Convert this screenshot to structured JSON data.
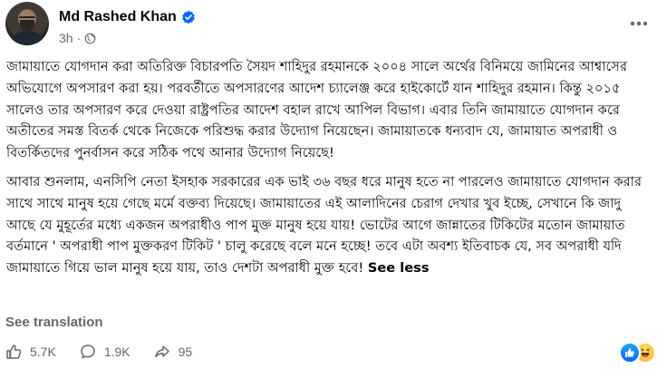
{
  "post": {
    "author": "Md Rashed Khan",
    "time": "3h",
    "separator": "·",
    "paragraph_1": "জামায়াতে যোগদান করা অতিরিক্ত বিচারপতি সৈয়দ শাহিদুর রহমানকে ২০০৪ সালে অর্থের বিনিময়ে জামিনের আশ্বাসের অভিযোগে অপসারণ করা হয়। পরবর্তীতে অপসারণের আদেশ চ্যালেঞ্জ করে হাইকোর্টে যান শাহিদুর রহমান। কিন্তু ২০১৫ সালেও তার অপসারণ করে দেওয়া রাষ্ট্রপতির আদেশ বহাল রাখে আপিল বিভাগ। এবার তিনি জামায়াতে যোগদান করে অতীতের সমস্ত বিতর্ক থেকে নিজেকে পরিশুদ্ধ করার উদ্যোগ নিয়েছেন। জামায়াতকে ধন্যবাদ যে, জামায়াত অপরাধী ও বিতর্কিতদের পুনর্বাসন করে সঠিক পথে আনার উদ্যোগ নিয়েছে!",
    "paragraph_2": "আবার শুনলাম, এনসিপি নেতা ইসহাক সরকারের এক ভাই ৩৬ বছর ধরে মানুষ হতে না পারলেও জামায়াতে যোগদান করার সাথে সাথে মানুষ হয়ে গেছে মর্মে বক্তব্য দিয়েছে। জামায়াতের এই আলাদিনের চেরাগ দেখার খুব ইচ্ছে, সেখানে কি জাদু আছে যে মুহূর্তের মধ্যে একজন অপরাধীও পাপ মুক্ত মানুষ হয়ে যায়! ভোটের আগে জান্নাতের টিকিটের মতোন জামায়াত বর্তমানে ' অপরাধী পাপ মুক্তকরণ টিকিট ' চালু করেছে বলে মনে হচ্ছে! তবে এটা অবশ্য ইতিবাচক যে, সব অপরাধী যদি জামায়াতে গিয়ে ভাল মানুষ হয়ে যায়, তাও দেশটা অপরাধী মুক্ত হবে!",
    "see_less": "See less",
    "see_translation": "See translation"
  },
  "stats": {
    "likes": "5.7K",
    "comments": "1.9K",
    "shares": "95"
  },
  "icons": {
    "verified": "verified-badge-icon",
    "privacy": "globe-icon",
    "more": "more-options-icon",
    "like": "like-icon",
    "comment": "comment-icon",
    "share": "share-icon",
    "reaction_like": "like-reaction-icon",
    "reaction_haha": "haha-reaction-icon"
  },
  "colors": {
    "text": "#050505",
    "secondary": "#65676b",
    "verified": "#0866ff"
  }
}
